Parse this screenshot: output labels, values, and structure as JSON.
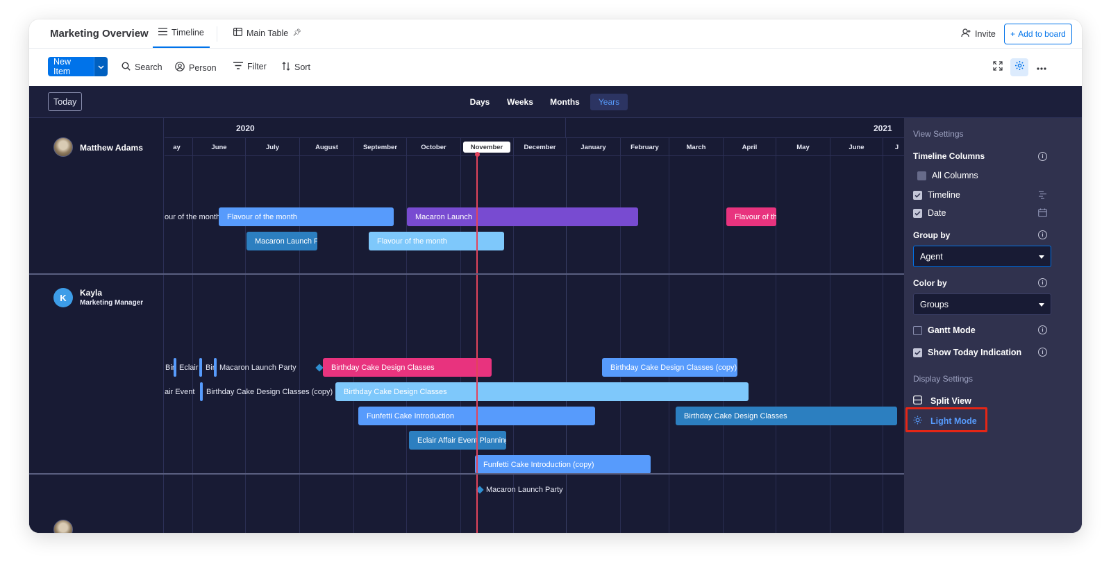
{
  "header": {
    "board_title": "Marketing Overview",
    "tabs": [
      {
        "label": "Timeline",
        "icon": "list-icon",
        "active": true
      },
      {
        "label": "Main Table",
        "icon": "table-icon",
        "pinned": true
      }
    ],
    "invite_label": "Invite",
    "add_to_board_label": "Add to board"
  },
  "toolbar": {
    "new_item_label": "New Item",
    "search_label": "Search",
    "person_label": "Person",
    "filter_label": "Filter",
    "sort_label": "Sort"
  },
  "timeline": {
    "today_label": "Today",
    "zoom_options": [
      "Days",
      "Weeks",
      "Months",
      "Years"
    ],
    "active_zoom": "Years",
    "years": [
      "2020",
      "2021"
    ],
    "months": [
      "ay",
      "June",
      "July",
      "August",
      "September",
      "October",
      "November",
      "December",
      "January",
      "February",
      "March",
      "April",
      "May",
      "June",
      "J"
    ],
    "current_month": "November",
    "groups": [
      {
        "name": "Matthew Adams",
        "subtitle": "",
        "items": [
          {
            "label": "our of the month"
          },
          {
            "label": "Flavour of the month"
          },
          {
            "label": "Macaron Launch"
          },
          {
            "label": "Flavour of the"
          },
          {
            "label": "Macaron Launch Pa"
          },
          {
            "label": "Flavour of the month"
          }
        ]
      },
      {
        "name": "Kayla",
        "subtitle": "Marketing Manager",
        "avatar_letter": "K",
        "items": [
          {
            "label": "Bir"
          },
          {
            "label": "Eclair"
          },
          {
            "label": "Bir"
          },
          {
            "label": "Macaron Launch Party"
          },
          {
            "label": "Birthday Cake Design Classes"
          },
          {
            "label": "Birthday Cake Design Classes (copy)"
          },
          {
            "label": "air Event"
          },
          {
            "label": "Birthday Cake Design Classes (copy)"
          },
          {
            "label": "Birthday Cake Design Classes"
          },
          {
            "label": "Funfetti Cake Introduction"
          },
          {
            "label": "Birthday Cake Design Classes"
          },
          {
            "label": "Eclair Affair Event Planning"
          },
          {
            "label": "Funfetti Cake Introduction (copy)"
          },
          {
            "label": "Macaron Launch Party"
          }
        ]
      }
    ]
  },
  "settings_panel": {
    "view_settings_title": "View Settings",
    "timeline_columns_label": "Timeline Columns",
    "all_columns_label": "All Columns",
    "timeline_label": "Timeline",
    "date_label": "Date",
    "group_by_label": "Group by",
    "group_by_value": "Agent",
    "color_by_label": "Color by",
    "color_by_value": "Groups",
    "gantt_mode_label": "Gantt Mode",
    "show_today_label": "Show Today Indication",
    "display_settings_title": "Display Settings",
    "split_view_label": "Split View",
    "light_mode_label": "Light Mode",
    "info_glyph": "i"
  },
  "colors": {
    "accent": "#0073ea",
    "dark_bg": "#181b34",
    "panel_bg": "#30324e",
    "today_line": "#e2445c",
    "highlight": "#e52616",
    "bar_blue": "#579bfc",
    "bar_light_blue": "#7ec8fb",
    "bar_purple": "#784bd1",
    "bar_pink": "#e8337e",
    "bar_steel": "#2c7fc0"
  }
}
